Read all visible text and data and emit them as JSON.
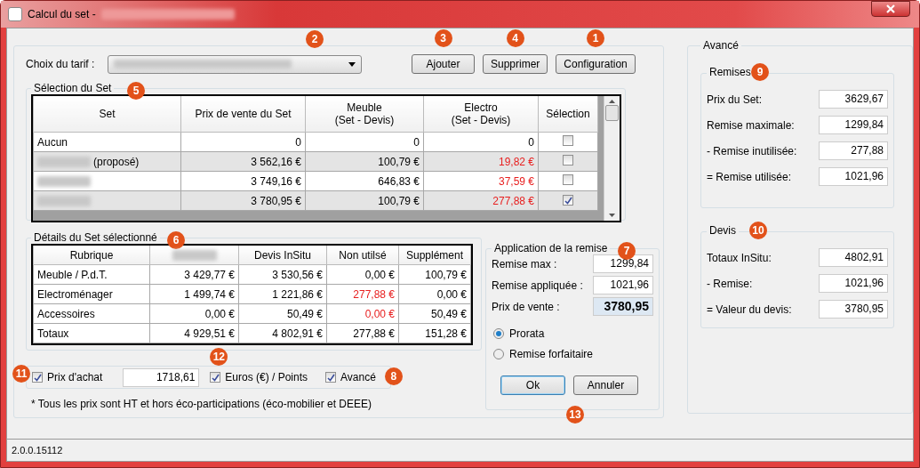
{
  "window": {
    "title": "Calcul du set -"
  },
  "tariff": {
    "label": "Choix du tarif :",
    "badge": "2"
  },
  "buttons": [
    {
      "label": "Ajouter",
      "badge": "3"
    },
    {
      "label": "Supprimer",
      "badge": "4"
    },
    {
      "label": "Configuration",
      "badge": "1"
    }
  ],
  "set_selection": {
    "title": "Sélection du Set",
    "badge": "5",
    "columns": [
      "Set",
      "Prix de vente du Set",
      "Meuble\n(Set - Devis)",
      "Electro\n(Set - Devis)",
      "Sélection"
    ],
    "rows": [
      {
        "redacted": false,
        "set": "Aucun",
        "price": "0",
        "meuble": "0",
        "electro": "0",
        "warning": false,
        "checked": false
      },
      {
        "redacted": true,
        "set": "(proposé)",
        "price": "3 562,16 €",
        "meuble": "100,79 €",
        "electro": "19,82 €",
        "warning": true,
        "checked": false
      },
      {
        "redacted": true,
        "price": "3 749,16 €",
        "meuble": "646,83 €",
        "electro": "37,59 €",
        "warning": true,
        "checked": false
      },
      {
        "redacted": true,
        "price": "3 780,95 €",
        "meuble": "100,79 €",
        "electro": "277,88 €",
        "warning": true,
        "checked": true
      }
    ]
  },
  "details": {
    "title": "Détails du Set sélectionné",
    "badge": "6",
    "columns": [
      {
        "label": "Rubrique",
        "redacted": false
      },
      {
        "redacted": true
      },
      {
        "label": "Devis InSitu",
        "redacted": false
      },
      {
        "label": "Non utilsé",
        "redacted": false
      },
      {
        "label": "Supplément",
        "redacted": false
      }
    ],
    "rows": [
      {
        "label": "Meuble / P.d.T.",
        "values": [
          "3 429,77 €",
          "3 530,56 €",
          "0,00 €",
          "100,79 €"
        ],
        "warnings": [
          false,
          false,
          false,
          false
        ]
      },
      {
        "label": "Electroménager",
        "values": [
          "1 499,74 €",
          "1 221,86 €",
          "277,88 €",
          "0,00 €"
        ],
        "warnings": [
          false,
          false,
          true,
          false
        ]
      },
      {
        "label": "Accessoires",
        "values": [
          "0,00 €",
          "50,49 €",
          "0,00 €",
          "50,49 €"
        ],
        "warnings": [
          false,
          false,
          true,
          false
        ]
      },
      {
        "label": "Totaux",
        "values": [
          "4 929,51 €",
          "4 802,91 €",
          "277,88 €",
          "151,28 €"
        ],
        "warnings": [
          false,
          false,
          false,
          false
        ]
      }
    ]
  },
  "options": [
    {
      "label": "Prix d'achat",
      "checked": true,
      "value": "1718,61",
      "badge": "11"
    },
    {
      "label": "Euros (€) / Points",
      "checked": true,
      "badge": "12"
    },
    {
      "label": "Avancé",
      "checked": true,
      "badge": "8"
    }
  ],
  "footnote": "* Tous les prix sont HT et hors éco-participations (éco-mobilier et DEEE)",
  "remise": {
    "title": "Application de la remise",
    "badge": "7",
    "fields": [
      {
        "label": "Remise max :",
        "value": "1299,84",
        "emphasis": false
      },
      {
        "label": "Remise appliquée :",
        "value": "1021,96",
        "emphasis": false
      },
      {
        "label": "Prix de vente :",
        "value": "3780,95",
        "emphasis": true
      }
    ],
    "radios": [
      {
        "label": "Prorata",
        "selected": true
      },
      {
        "label": "Remise forfaitaire",
        "selected": false
      }
    ],
    "buttons": [
      {
        "label": "Ok",
        "default": true
      },
      {
        "label": "Annuler",
        "default": false
      }
    ],
    "buttons_badge": "13"
  },
  "advanced": {
    "title": "Avancé",
    "groups": [
      {
        "title": "Remises",
        "badge": "9",
        "fields": [
          {
            "label": "Prix du Set:",
            "value": "3629,67"
          },
          {
            "label": "Remise maximale:",
            "value": "1299,84"
          },
          {
            "label": "- Remise inutilisée:",
            "value": "277,88"
          },
          {
            "label": "= Remise utilisée:",
            "value": "1021,96"
          }
        ]
      },
      {
        "title": "Devis",
        "badge": "10",
        "fields": [
          {
            "label": "Totaux InSitu:",
            "value": "4802,91"
          },
          {
            "label": "- Remise:",
            "value": "1021,96"
          },
          {
            "label": "= Valeur du devis:",
            "value": "3780,95"
          }
        ]
      }
    ]
  },
  "status_bar": {
    "version": "2.0.0.15112"
  }
}
